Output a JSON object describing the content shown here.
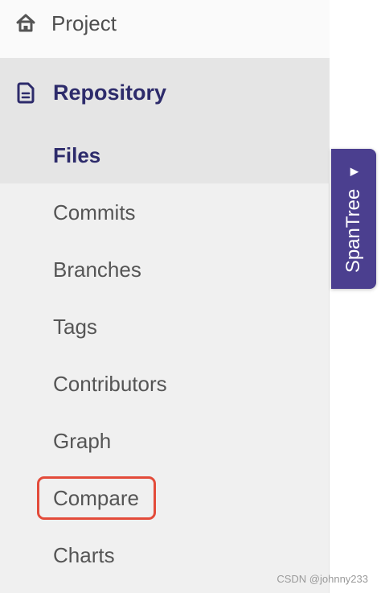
{
  "nav": {
    "project": {
      "label": "Project",
      "icon": "home-icon"
    },
    "repository": {
      "label": "Repository",
      "icon": "document-icon"
    },
    "files": {
      "label": "Files"
    },
    "items": [
      {
        "label": "Commits"
      },
      {
        "label": "Branches"
      },
      {
        "label": "Tags"
      },
      {
        "label": "Contributors"
      },
      {
        "label": "Graph"
      },
      {
        "label": "Compare",
        "highlighted": true
      },
      {
        "label": "Charts"
      }
    ]
  },
  "spantree": {
    "label": "SpanTree",
    "arrow": "▼"
  },
  "watermark": "CSDN @johnny233",
  "colors": {
    "active_text": "#2d2b6b",
    "sidebar_bg": "#f0f0f0",
    "active_bg": "#e5e5e5",
    "highlight_border": "#e34b3a",
    "spantree_bg": "#4b3f8f"
  }
}
